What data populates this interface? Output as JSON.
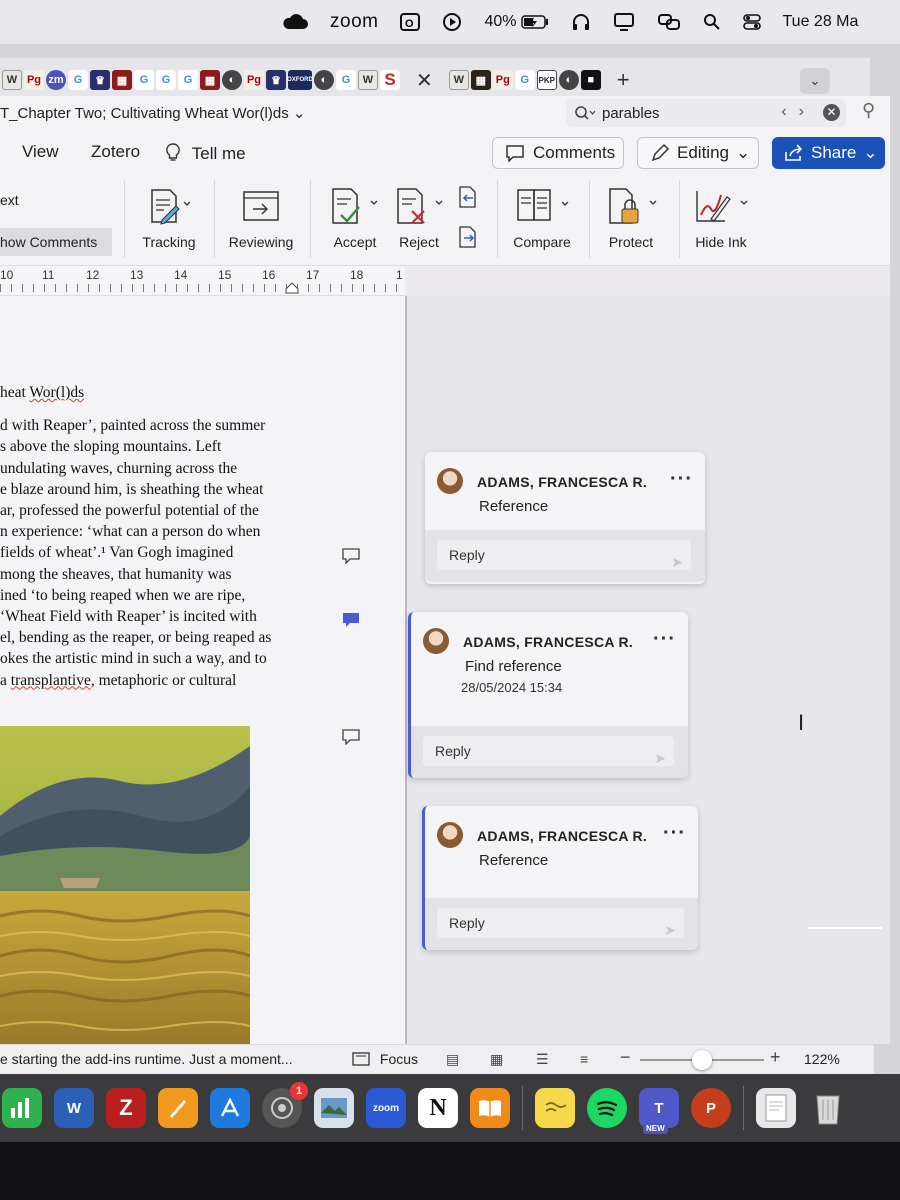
{
  "menubar": {
    "zoom_label": "zoom",
    "battery": "40%",
    "clock": "Tue 28 Ma"
  },
  "tabs": {
    "favicons": [
      "W",
      "Pg",
      "zm",
      "G",
      "♛",
      "▦",
      "G",
      "G",
      "G",
      "▦",
      "◐",
      "Pg",
      "OXFORD",
      "◐",
      "G",
      "W",
      "S"
    ],
    "favicons_after": [
      "W",
      "▦",
      "Pg",
      "G",
      "PKP",
      "◐",
      "■"
    ]
  },
  "document": {
    "title": "T_Chapter Two; Cultivating Wheat Wor(l)ds",
    "search_value": "parables"
  },
  "ribbon_tabs": {
    "view": "View",
    "zotero": "Zotero",
    "tell_me": "Tell me",
    "comments": "Comments",
    "editing": "Editing",
    "share": "Share"
  },
  "ribbon": {
    "ext": "ext",
    "show_comments": "how Comments",
    "tracking": "Tracking",
    "reviewing": "Reviewing",
    "accept": "Accept",
    "reject": "Reject",
    "compare": "Compare",
    "protect": "Protect",
    "hide_ink": "Hide Ink"
  },
  "ruler": [
    "10",
    "11",
    "12",
    "13",
    "14",
    "15",
    "16",
    "17",
    "18",
    "1"
  ],
  "body": {
    "heading_a": "heat ",
    "heading_b": "Wor(l)ds",
    "lines": [
      "d with Reaper’, painted across the summer",
      "s above the sloping mountains. Left",
      "undulating waves, churning across the",
      "e blaze around him, is sheathing the wheat",
      "ar, professed the powerful potential of the",
      "n experience: ‘what can a person do when",
      "fields of wheat’.¹ Van Gogh imagined",
      "mong the sheaves, that humanity was",
      "ined ‘to being reaped when we are ripe,",
      "‘Wheat Field with Reaper’ is incited with",
      "el, bending as the reaper, or being reaped as",
      "okes the artistic mind in such a way, and to"
    ],
    "last_a": "a ",
    "last_b": "transplantive",
    "last_c": ", metaphoric or cultural"
  },
  "comments": [
    {
      "author": "ADAMS, FRANCESCA R.",
      "text": "Reference",
      "timestamp": "",
      "reply": "Reply"
    },
    {
      "author": "ADAMS, FRANCESCA R.",
      "text": "Find reference",
      "timestamp": "28/05/2024 15:34",
      "reply": "Reply"
    },
    {
      "author": "ADAMS, FRANCESCA R.",
      "text": "Reference",
      "timestamp": "",
      "reply": "Reply"
    }
  ],
  "statusbar": {
    "message": "e starting the add-ins runtime. Just a moment...",
    "focus": "Focus",
    "zoom": "122%",
    "zoom_fraction": 0.5
  },
  "dock": {
    "zoom_label": "zoom",
    "badge": "1",
    "new_tag": "NEW"
  },
  "colors": {
    "share": "#1b52b8",
    "active_comment": "#4c5bd4"
  }
}
